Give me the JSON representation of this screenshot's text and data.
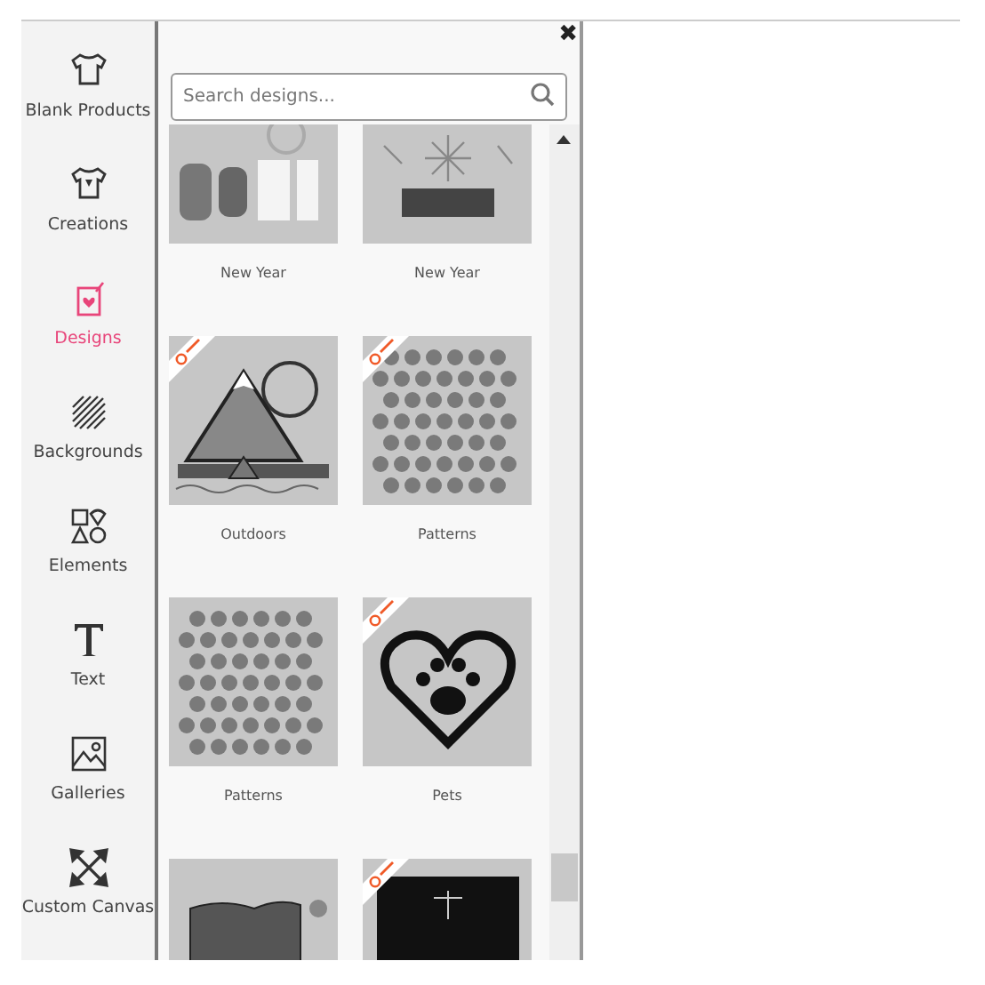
{
  "sidebar": {
    "items": [
      {
        "label": "Blank Products",
        "selected": false
      },
      {
        "label": "Creations",
        "selected": false
      },
      {
        "label": "Designs",
        "selected": true
      },
      {
        "label": "Backgrounds",
        "selected": false
      },
      {
        "label": "Elements",
        "selected": false
      },
      {
        "label": "Text",
        "selected": false
      },
      {
        "label": "Galleries",
        "selected": false
      },
      {
        "label": "Custom Canvas",
        "selected": false
      }
    ]
  },
  "panel": {
    "close": "✖",
    "search": {
      "placeholder": "Search designs..."
    },
    "designs": [
      {
        "label": "New Year",
        "kind": "numbers",
        "premium": false
      },
      {
        "label": "New Year",
        "kind": "fireworks",
        "premium": false
      },
      {
        "label": "Outdoors",
        "kind": "mountains",
        "premium": true
      },
      {
        "label": "Patterns",
        "kind": "pattern",
        "premium": true
      },
      {
        "label": "Patterns",
        "kind": "pattern",
        "premium": false
      },
      {
        "label": "Pets",
        "kind": "paw",
        "premium": true
      },
      {
        "kind": "banner",
        "premium": false
      },
      {
        "kind": "dark",
        "premium": true
      }
    ]
  }
}
